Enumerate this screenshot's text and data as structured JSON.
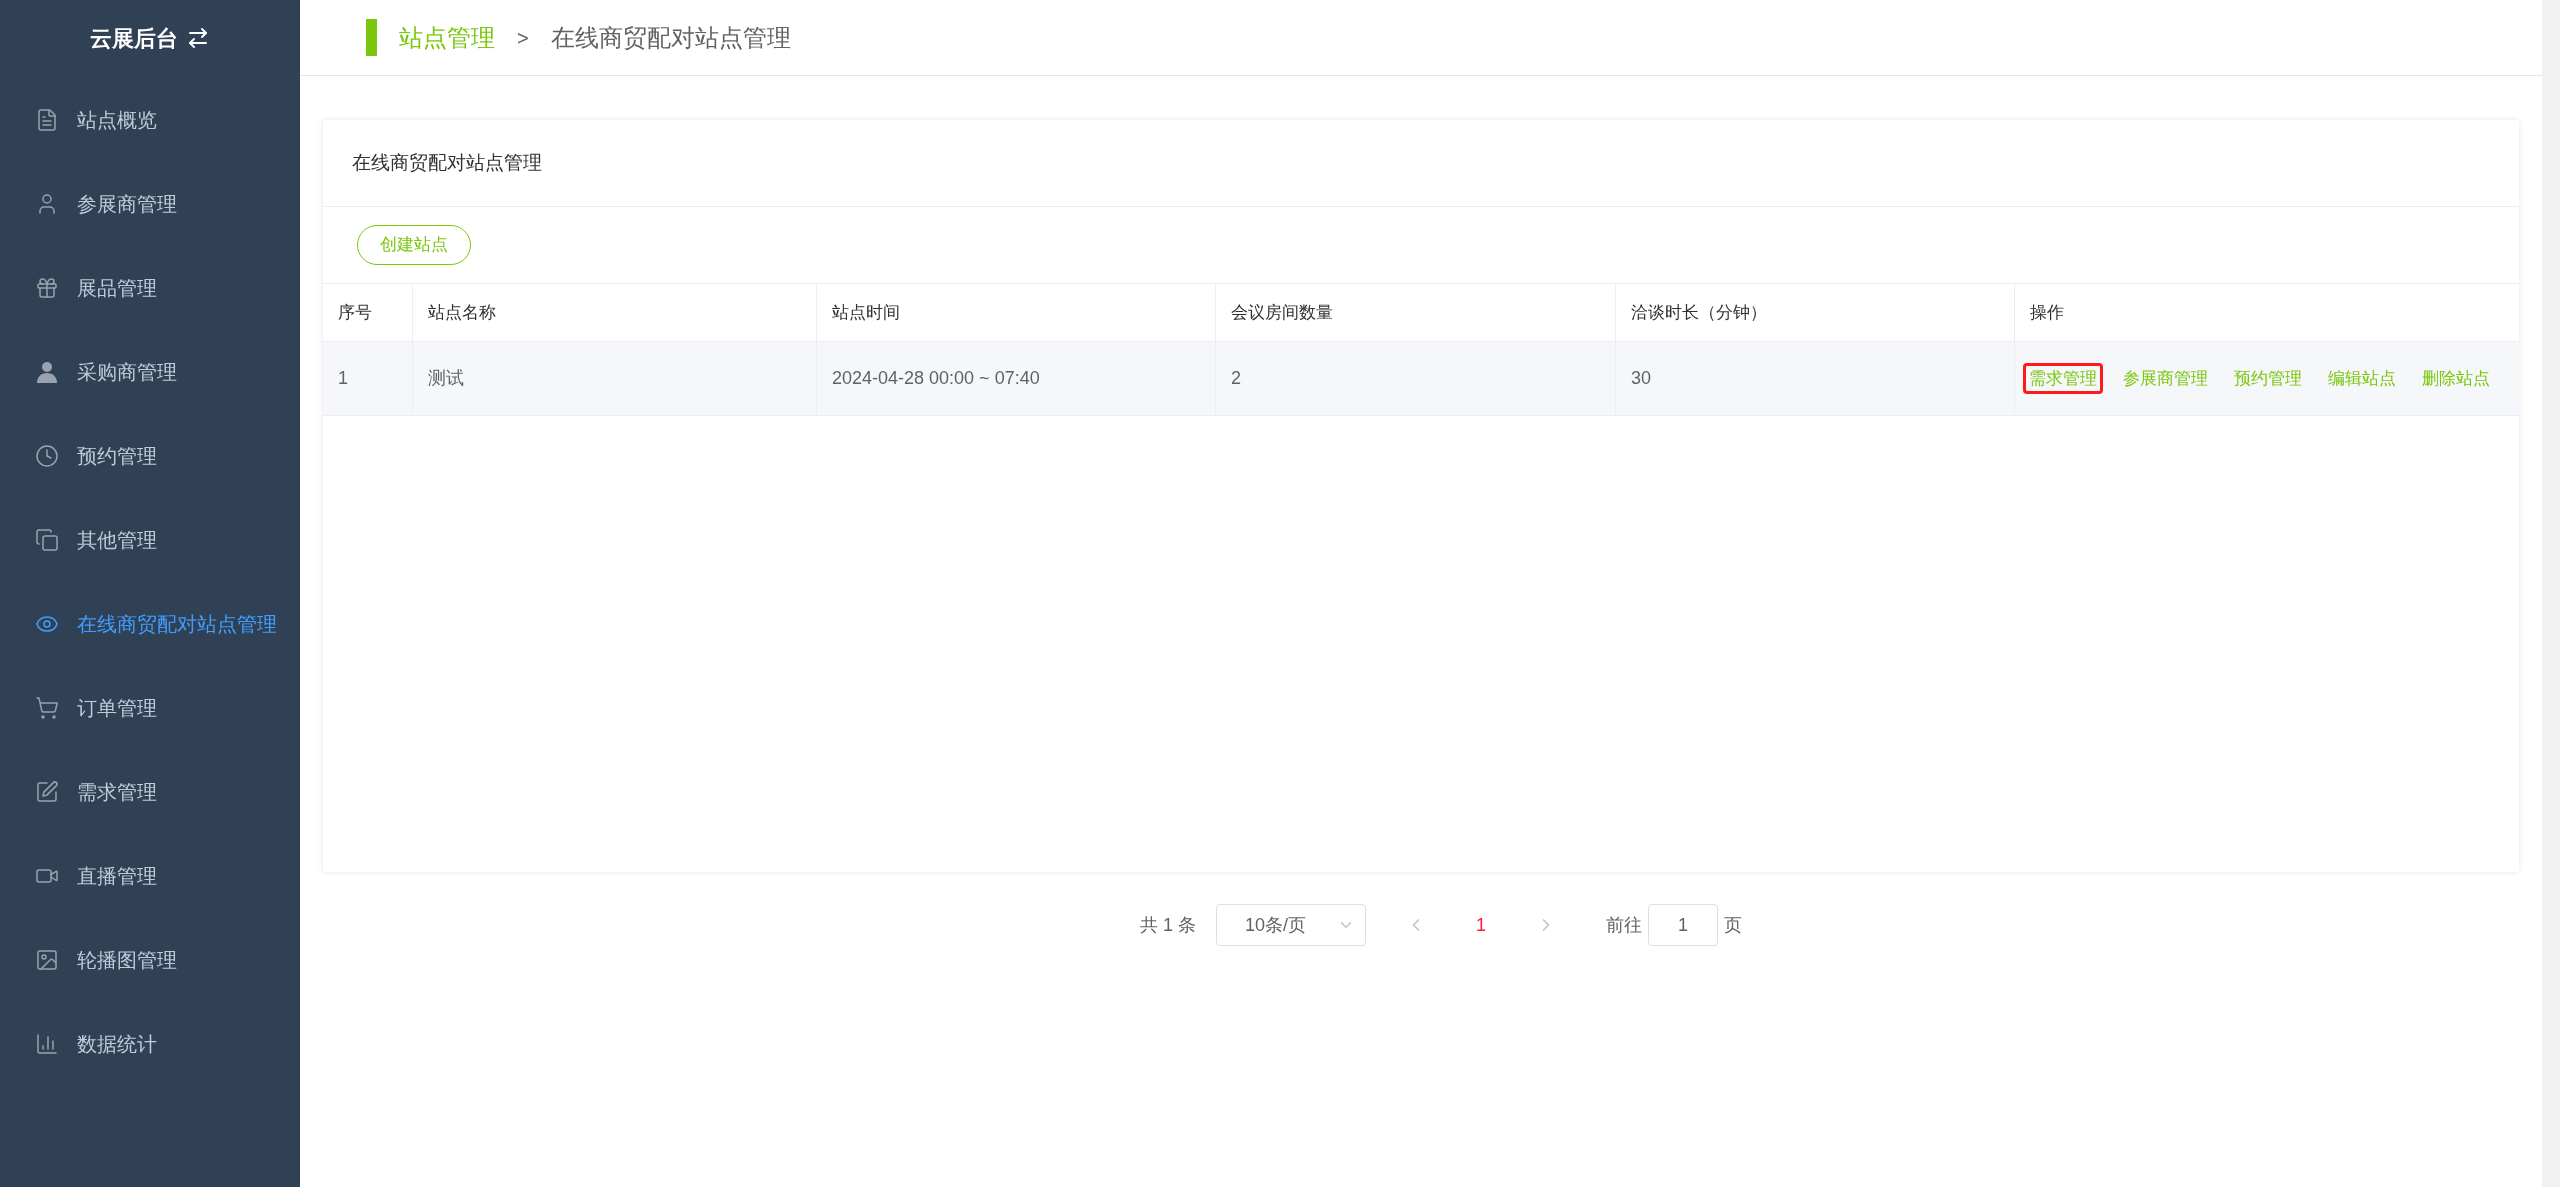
{
  "sidebar": {
    "title": "云展后台",
    "items": [
      {
        "label": "站点概览",
        "selected": false
      },
      {
        "label": "参展商管理",
        "selected": false
      },
      {
        "label": "展品管理",
        "selected": false
      },
      {
        "label": "采购商管理",
        "selected": false
      },
      {
        "label": "预约管理",
        "selected": false
      },
      {
        "label": "其他管理",
        "selected": false
      },
      {
        "label": "在线商贸配对站点管理",
        "selected": true
      },
      {
        "label": "订单管理",
        "selected": false
      },
      {
        "label": "需求管理",
        "selected": false
      },
      {
        "label": "直播管理",
        "selected": false
      },
      {
        "label": "轮播图管理",
        "selected": false
      },
      {
        "label": "数据统计",
        "selected": false
      }
    ]
  },
  "breadcrumb": {
    "items": [
      "站点管理",
      "在线商贸配对站点管理"
    ],
    "separator": ">"
  },
  "card": {
    "title": "在线商贸配对站点管理",
    "create_button": "创建站点"
  },
  "table": {
    "columns": [
      "序号",
      "站点名称",
      "站点时间",
      "会议房间数量",
      "洽谈时长（分钟）",
      "操作"
    ],
    "rows": [
      {
        "cells": [
          "1",
          "测试",
          "2024-04-28 00:00 ~ 07:40",
          "2",
          "30"
        ],
        "actions": [
          {
            "label": "需求管理",
            "highlighted": true
          },
          {
            "label": "参展商管理",
            "highlighted": false
          },
          {
            "label": "预约管理",
            "highlighted": false
          },
          {
            "label": "编辑站点",
            "highlighted": false
          },
          {
            "label": "删除站点",
            "highlighted": false
          }
        ]
      }
    ]
  },
  "pagination": {
    "total": "共 1 条",
    "page_size": "10条/页",
    "pages": [
      {
        "label": "1",
        "selected": true
      }
    ],
    "goto_label": "前往",
    "goto_value": "1",
    "goto_suffix": "页"
  }
}
